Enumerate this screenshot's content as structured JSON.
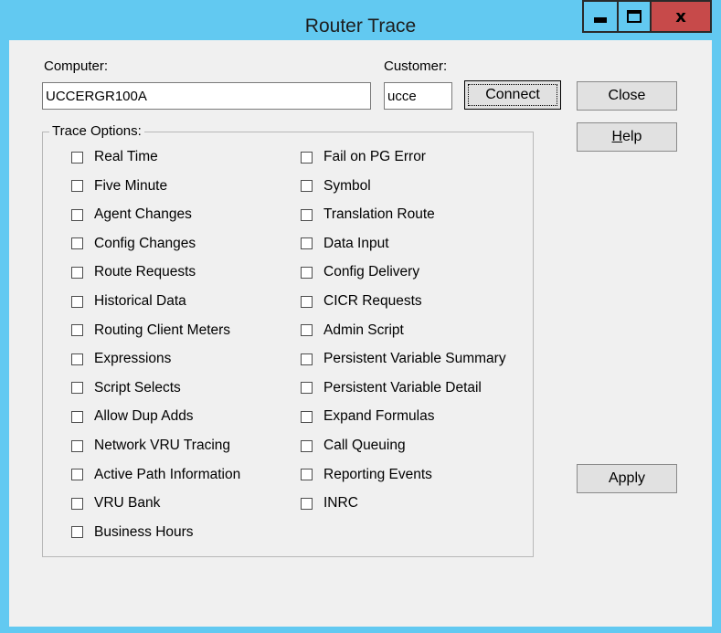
{
  "window": {
    "title": "Router Trace",
    "minimize_glyph": "minimize-icon",
    "maximize_glyph": "maximize-icon",
    "close_glyph": "x"
  },
  "computer": {
    "label": "Computer:",
    "value": "UCCERGR100A"
  },
  "customer": {
    "label": "Customer:",
    "value": "ucce"
  },
  "buttons": {
    "connect": "Connect",
    "close": "Close",
    "help": "Help",
    "apply": "Apply"
  },
  "trace_options": {
    "legend": "Trace Options:",
    "left": [
      {
        "label": "Real Time",
        "checked": false
      },
      {
        "label": "Five Minute",
        "checked": false
      },
      {
        "label": "Agent Changes",
        "checked": false
      },
      {
        "label": "Config Changes",
        "checked": false
      },
      {
        "label": "Route Requests",
        "checked": false
      },
      {
        "label": "Historical Data",
        "checked": false
      },
      {
        "label": "Routing Client Meters",
        "checked": false
      },
      {
        "label": "Expressions",
        "checked": false
      },
      {
        "label": "Script Selects",
        "checked": false
      },
      {
        "label": "Allow Dup Adds",
        "checked": false
      },
      {
        "label": "Network VRU Tracing",
        "checked": false
      },
      {
        "label": "Active Path Information",
        "checked": false
      },
      {
        "label": "VRU Bank",
        "checked": false
      },
      {
        "label": "Business Hours",
        "checked": false
      }
    ],
    "right": [
      {
        "label": "Fail on PG Error",
        "checked": false
      },
      {
        "label": "Symbol",
        "checked": false
      },
      {
        "label": "Translation Route",
        "checked": false
      },
      {
        "label": "Data Input",
        "checked": false
      },
      {
        "label": "Config Delivery",
        "checked": false
      },
      {
        "label": "CICR Requests",
        "checked": false
      },
      {
        "label": "Admin Script",
        "checked": false
      },
      {
        "label": "Persistent Variable Summary",
        "checked": false
      },
      {
        "label": "Persistent Variable Detail",
        "checked": false
      },
      {
        "label": "Expand Formulas",
        "checked": false
      },
      {
        "label": "Call Queuing",
        "checked": false
      },
      {
        "label": "Reporting Events",
        "checked": false
      },
      {
        "label": "INRC",
        "checked": false
      }
    ]
  },
  "colors": {
    "titlebar": "#62c9f1",
    "close_button": "#c74a4a",
    "client_bg": "#f0f0f0"
  }
}
